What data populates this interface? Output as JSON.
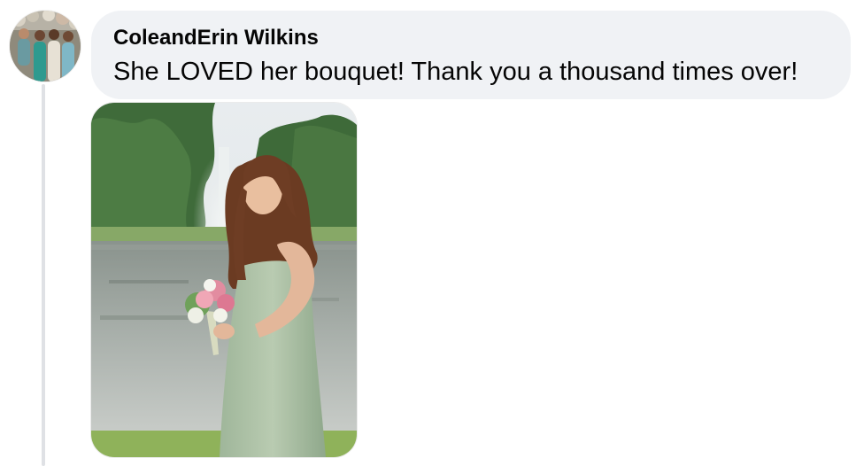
{
  "comment": {
    "author": "ColeandErin Wilkins",
    "text": "She LOVED her bouquet! Thank you a thousand times over!",
    "avatar_icon": "profile-photo-avatar",
    "photo": "photo-attachment"
  },
  "colors": {
    "bubble_background": "#f0f2f5",
    "text": "#050505",
    "thread_line": "#dfe1e5"
  }
}
